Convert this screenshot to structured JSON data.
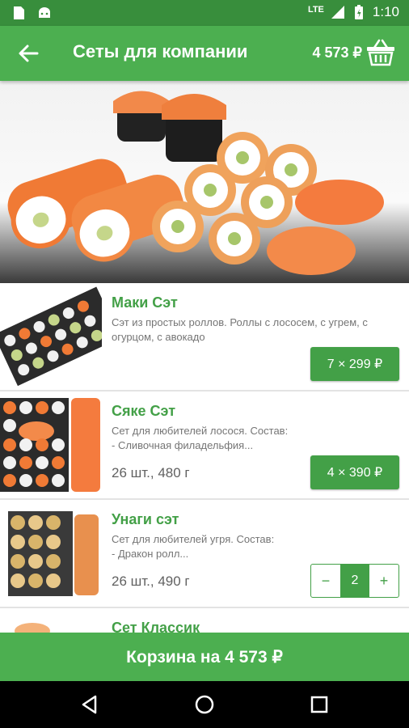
{
  "status_bar": {
    "network": "LTE",
    "time": "1:10",
    "icons": [
      "sd-card-icon",
      "android-icon",
      "signal-icon",
      "battery-icon"
    ]
  },
  "toolbar": {
    "title": "Сеты для компании",
    "total": "4 573 ₽"
  },
  "products": [
    {
      "name": "Маки Сэт",
      "description": "Сэт из простых роллов. Роллы с лососем, с угрем, с огурцом, с авокадо",
      "meta": "",
      "price": "7 × 299 ₽"
    },
    {
      "name": "Сяке Сэт",
      "description": "Сет для любителей лосося. Состав:\n- Сливочная филадельфия...",
      "meta": "26 шт., 480 г",
      "price": "4 × 390 ₽"
    },
    {
      "name": "Унаги сэт",
      "description": "Сет для любителей угря. Состав:\n- Дракон ролл...",
      "meta": "26 шт., 490 г",
      "stepper": {
        "minus": "−",
        "qty": "2",
        "plus": "+"
      }
    },
    {
      "name": "Сет Классик",
      "description": "",
      "meta": ""
    }
  ],
  "cart_button": "Корзина на 4 573 ₽",
  "colors": {
    "primary": "#4caf50",
    "primary_dark": "#388e3c",
    "accent": "#43a047"
  }
}
